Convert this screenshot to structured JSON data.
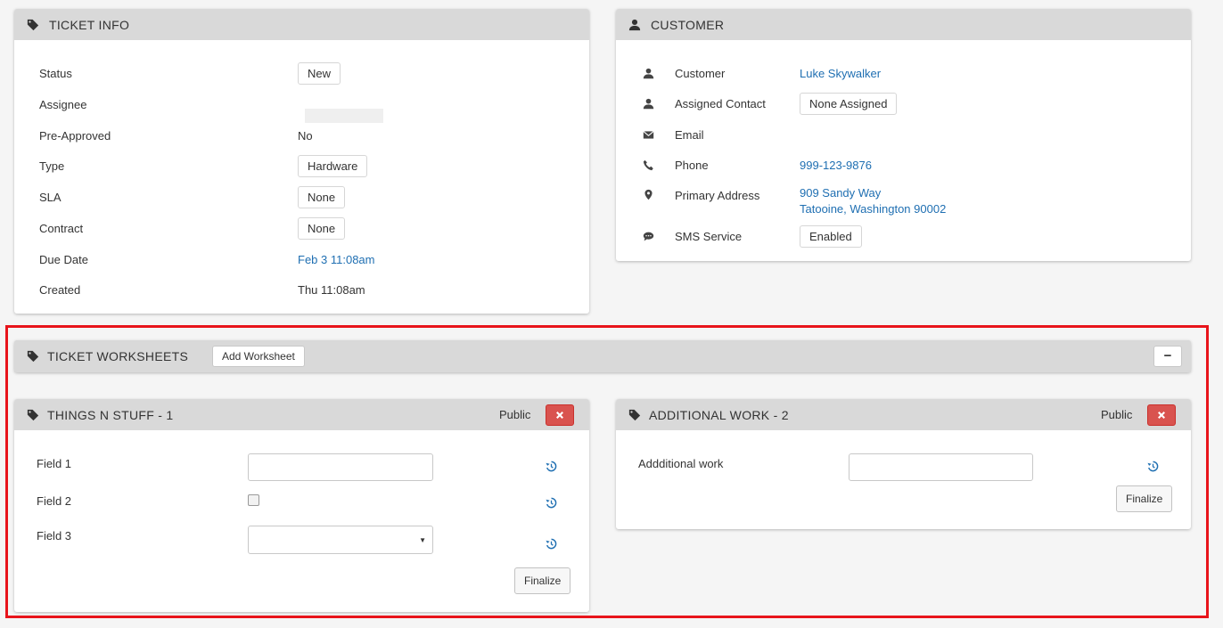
{
  "ticket_info": {
    "title": "TICKET INFO",
    "rows": [
      {
        "label": "Status",
        "value": "New"
      },
      {
        "label": "Assignee",
        "value": ""
      },
      {
        "label": "Pre-Approved",
        "value": "No"
      },
      {
        "label": "Type",
        "value": "Hardware"
      },
      {
        "label": "SLA",
        "value": "None"
      },
      {
        "label": "Contract",
        "value": "None"
      },
      {
        "label": "Due Date",
        "value": "Feb 3 11:08am"
      },
      {
        "label": "Created",
        "value": "Thu 11:08am"
      }
    ]
  },
  "customer": {
    "title": "CUSTOMER",
    "rows": [
      {
        "label": "Customer",
        "value": "Luke Skywalker",
        "icon": "user-icon"
      },
      {
        "label": "Assigned Contact",
        "value": "None Assigned",
        "icon": "user-icon"
      },
      {
        "label": "Email",
        "value": "",
        "icon": "envelope-icon"
      },
      {
        "label": "Phone",
        "value": "999-123-9876",
        "icon": "phone-icon"
      },
      {
        "label": "Primary Address",
        "value_line1": "909 Sandy Way",
        "value_line2": "Tatooine, Washington 90002",
        "icon": "map-marker-icon"
      },
      {
        "label": "SMS Service",
        "value": "Enabled",
        "icon": "comment-icon"
      }
    ]
  },
  "worksheets": {
    "title": "TICKET WORKSHEETS",
    "add_label": "Add Worksheet",
    "collapse_label": "−",
    "sheets": [
      {
        "title": "THINGS N STUFF - 1",
        "visibility": "Public",
        "fields": [
          {
            "label": "Field 1",
            "type": "text",
            "value": ""
          },
          {
            "label": "Field 2",
            "type": "checkbox",
            "checked": false
          },
          {
            "label": "Field 3",
            "type": "select",
            "value": ""
          }
        ],
        "finalize_label": "Finalize"
      },
      {
        "title": "ADDITIONAL WORK - 2",
        "visibility": "Public",
        "fields": [
          {
            "label": "Addditional work",
            "type": "text",
            "value": ""
          }
        ],
        "finalize_label": "Finalize"
      }
    ]
  },
  "colors": {
    "link": "#1f6fb2",
    "header_bg": "#d9d9d9",
    "danger": "#d9534f",
    "highlight": "#e8141b"
  }
}
